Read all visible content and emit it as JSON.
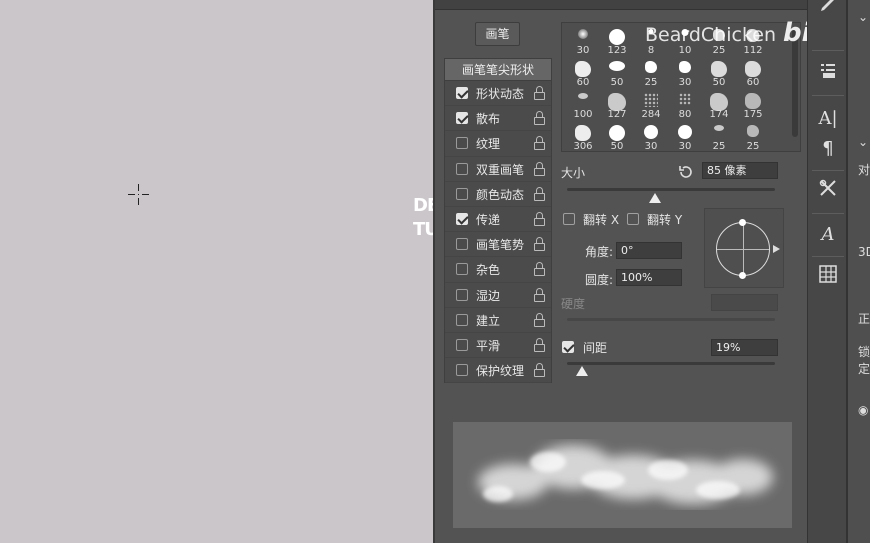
{
  "canvas": {
    "partial_text_line1": "DE",
    "partial_text_line2": "TU"
  },
  "panel": {
    "brush_button": "画笔",
    "options_header": "画笔笔尖形状",
    "options": [
      {
        "label": "形状动态",
        "checked": true
      },
      {
        "label": "散布",
        "checked": true
      },
      {
        "label": "纹理",
        "checked": false
      },
      {
        "label": "双重画笔",
        "checked": false
      },
      {
        "label": "颜色动态",
        "checked": false
      },
      {
        "label": "传递",
        "checked": true
      },
      {
        "label": "画笔笔势",
        "checked": false
      },
      {
        "label": "杂色",
        "checked": false
      },
      {
        "label": "湿边",
        "checked": false
      },
      {
        "label": "建立",
        "checked": false
      },
      {
        "label": "平滑",
        "checked": false
      },
      {
        "label": "保护纹理",
        "checked": false
      }
    ],
    "presets": [
      "30",
      "123",
      "8",
      "10",
      "25",
      "112",
      "60",
      "50",
      "25",
      "30",
      "50",
      "60",
      "100",
      "127",
      "284",
      "80",
      "174",
      "175",
      "306",
      "50",
      "30",
      "30",
      "25",
      "25"
    ],
    "size_label": "大小",
    "size_value": "85 像素",
    "size_slider_percent": 26,
    "flip_x_label": "翻转 X",
    "flip_y_label": "翻转 Y",
    "angle_label": "角度:",
    "angle_value": "0°",
    "roundness_label": "圆度:",
    "roundness_value": "100%",
    "hardness_label": "硬度",
    "spacing_label": "间距",
    "spacing_checked": true,
    "spacing_value": "19%",
    "spacing_slider_percent": 19
  },
  "watermark": {
    "text": "BeardChicken",
    "logo": "bilibili"
  },
  "right_panel": {
    "text1": "对",
    "text2": "3D",
    "text3": "正",
    "text4": "锁定"
  },
  "colors": {
    "panel_bg": "#535353",
    "canvas_bg": "#cbc6ca",
    "toolbar_bg": "#474747"
  }
}
